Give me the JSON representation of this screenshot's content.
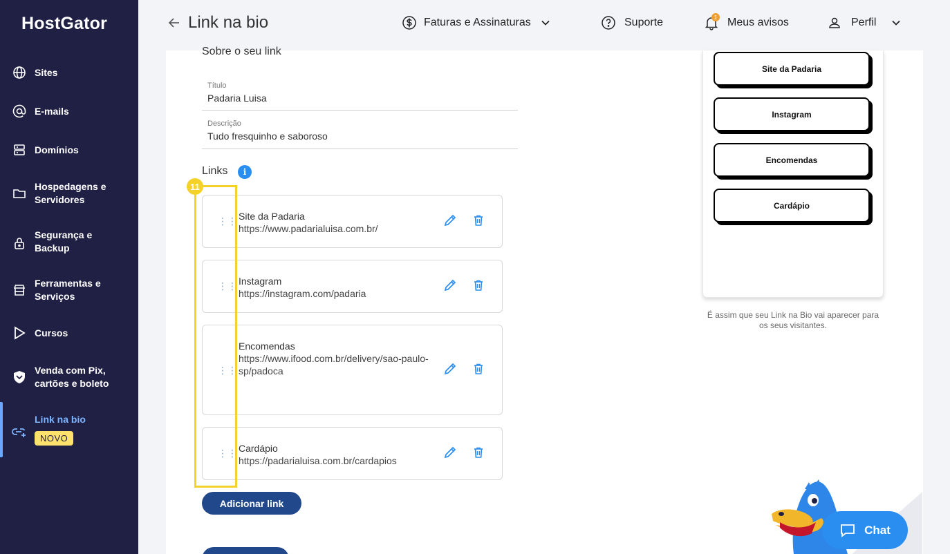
{
  "brand": {
    "name": "HostGator"
  },
  "sidebar": {
    "items": [
      {
        "label": "Sites",
        "icon": "globe-icon"
      },
      {
        "label": "E-mails",
        "icon": "at-icon"
      },
      {
        "label": "Domínios",
        "icon": "server-icon"
      },
      {
        "label": "Hospedagens e Servidores",
        "icon": "folder-icon"
      },
      {
        "label": "Segurança e Backup",
        "icon": "lock-icon"
      },
      {
        "label": "Ferramentas e Serviços",
        "icon": "store-icon"
      },
      {
        "label": "Cursos",
        "icon": "play-icon"
      },
      {
        "label": "Venda com Pix, cartões e boleto",
        "icon": "shield-icon"
      },
      {
        "label": "Link na bio",
        "icon": "link-add-icon",
        "badge": "NOVO",
        "active": true
      }
    ]
  },
  "header": {
    "title": "Link na bio",
    "billing_label": "Faturas e Assinaturas",
    "support_label": "Suporte",
    "notices_label": "Meus avisos",
    "notices_count": "1",
    "profile_label": "Perfil"
  },
  "form": {
    "section_title": "Sobre o seu link",
    "title_label": "Título",
    "title_value": "Padaria Luisa",
    "description_label": "Descrição",
    "description_value": "Tudo fresquinho e saboroso",
    "links_title": "Links",
    "info_glyph": "i"
  },
  "links": [
    {
      "name": "Site da Padaria",
      "url": "https://www.padarialuisa.com.br/"
    },
    {
      "name": "Instagram",
      "url": "https://instagram.com/padaria"
    },
    {
      "name": "Encomendas",
      "url": "https://www.ifood.com.br/delivery/sao-paulo-sp/padoca"
    },
    {
      "name": "Cardápio",
      "url": "https://padarialuisa.com.br/cardapios"
    }
  ],
  "step_badge": "11",
  "add_link_label": "Adicionar link",
  "preview": {
    "buttons": [
      "Site da Padaria",
      "Instagram",
      "Encomendas",
      "Cardápio"
    ],
    "caption": "É assim que seu Link na Bio vai aparecer para os seus visitantes."
  },
  "chat": {
    "label": "Chat"
  },
  "colors": {
    "sidebar_bg": "#1f2044",
    "accent_blue": "#2a8ef0",
    "primary_button": "#21488a",
    "highlight": "#f4d22a",
    "badge_novo": "#ffe26b"
  }
}
